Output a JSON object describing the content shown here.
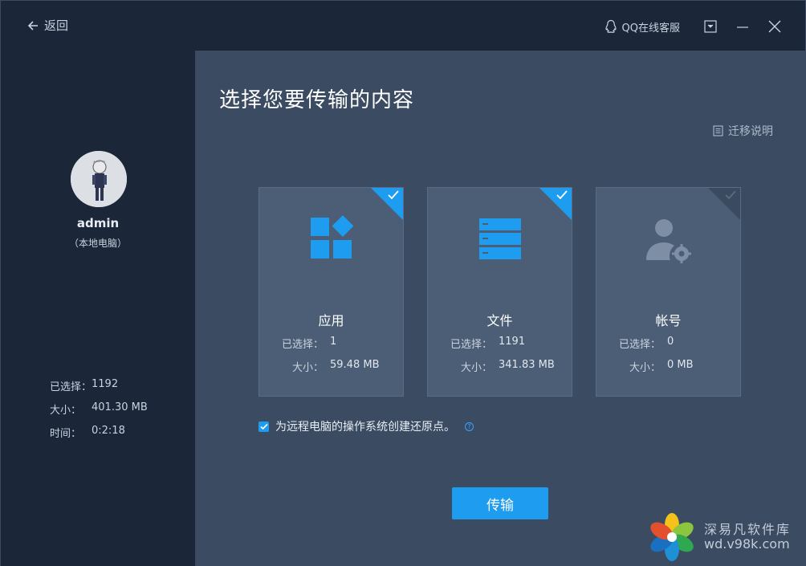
{
  "titlebar": {
    "back_label": "返回",
    "qq_label": "QQ在线客服"
  },
  "user": {
    "name": "admin",
    "subtitle": "（本地电脑）"
  },
  "summary": {
    "selected_label": "已选择：",
    "selected_value": "1192",
    "size_label": "大小：",
    "size_value": "401.30 MB",
    "time_label": "时间：",
    "time_value": "0:2:18"
  },
  "main": {
    "title": "选择您要传输的内容",
    "guide_label": "迁移说明"
  },
  "cards": [
    {
      "name": "应用",
      "selected_label": "已选择：",
      "selected_value": "1",
      "size_label": "大小：",
      "size_value": "59.48 MB",
      "checked": true,
      "icon": "apps-icon"
    },
    {
      "name": "文件",
      "selected_label": "已选择：",
      "selected_value": "1191",
      "size_label": "大小：",
      "size_value": "341.83 MB",
      "checked": true,
      "icon": "files-icon"
    },
    {
      "name": "帐号",
      "selected_label": "已选择：",
      "selected_value": "0",
      "size_label": "大小：",
      "size_value": "0 MB",
      "checked": false,
      "icon": "account-settings-icon"
    }
  ],
  "restore": {
    "label": "为远程电脑的操作系统创建还原点。",
    "checked": true
  },
  "transfer_button": "传输",
  "watermark": {
    "name": "深易凡软件库",
    "url": "wd.v98k.com"
  },
  "colors": {
    "accent": "#1e9cf0",
    "sidebar_bg": "#1b2638",
    "main_bg": "#3b4b62",
    "card_bg": "#4c5e76",
    "unchecked_corner": "#3a4a5f"
  }
}
